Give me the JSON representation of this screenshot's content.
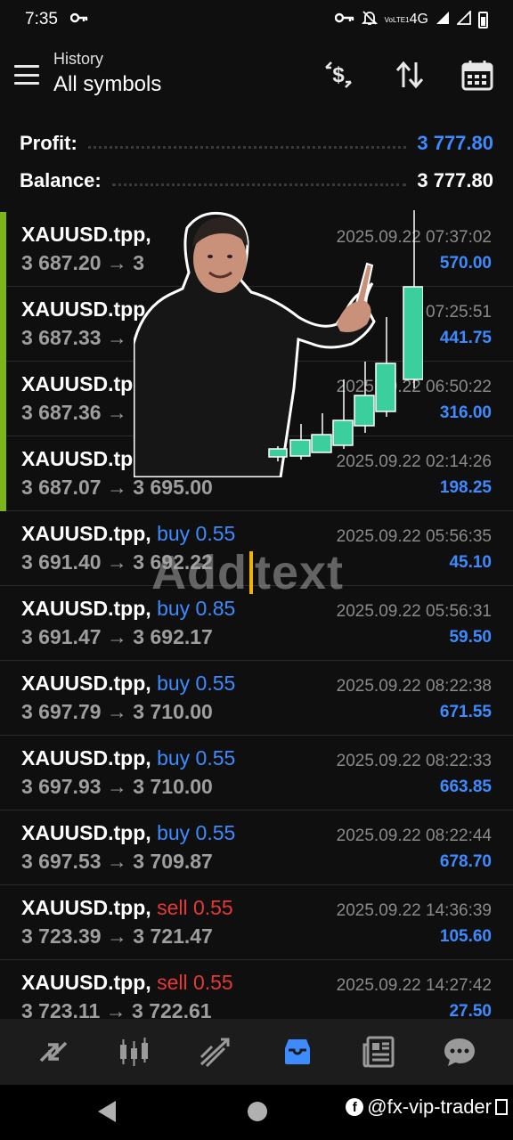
{
  "status": {
    "time": "7:35",
    "network": "4G",
    "volte": "VoLTE1"
  },
  "header": {
    "subtitle": "History",
    "title": "All symbols"
  },
  "summary": {
    "profit_label": "Profit:",
    "profit_value": "3 777.80",
    "balance_label": "Balance:",
    "balance_value": "3 777.80"
  },
  "trades": [
    {
      "symbol": "XAUUSD.tpp,",
      "side": "",
      "side_type": "buy",
      "prices": "3 687.20 → 3",
      "time": "2025.09.22 07:37:02",
      "profit": "570.00",
      "highlight": true
    },
    {
      "symbol": "XAUUSD.tpp",
      "side": "",
      "side_type": "buy",
      "prices": "3 687.33 →",
      "time": "07:25:51",
      "profit": "441.75",
      "highlight": true
    },
    {
      "symbol": "XAUUSD.tpp",
      "side": "",
      "side_type": "buy",
      "prices": "3 687.36 →",
      "time": "2025.09.22 06:50:22",
      "profit": "316.00",
      "highlight": true
    },
    {
      "symbol": "XAUUSD.tpp",
      "side": "",
      "side_type": "buy",
      "prices": "3 687.07 → 3 695.00",
      "time": "2025.09.22 02:14:26",
      "profit": "198.25",
      "highlight": true
    },
    {
      "symbol": "XAUUSD.tpp,",
      "side": "buy 0.55",
      "side_type": "buy",
      "prices": "3 691.40 → 3 692.22",
      "time": "2025.09.22 05:56:35",
      "profit": "45.10",
      "highlight": false
    },
    {
      "symbol": "XAUUSD.tpp,",
      "side": "buy 0.85",
      "side_type": "buy",
      "prices": "3 691.47 → 3 692.17",
      "time": "2025.09.22 05:56:31",
      "profit": "59.50",
      "highlight": false
    },
    {
      "symbol": "XAUUSD.tpp,",
      "side": "buy 0.55",
      "side_type": "buy",
      "prices": "3 697.79 → 3 710.00",
      "time": "2025.09.22 08:22:38",
      "profit": "671.55",
      "highlight": false
    },
    {
      "symbol": "XAUUSD.tpp,",
      "side": "buy 0.55",
      "side_type": "buy",
      "prices": "3 697.93 → 3 710.00",
      "time": "2025.09.22 08:22:33",
      "profit": "663.85",
      "highlight": false
    },
    {
      "symbol": "XAUUSD.tpp,",
      "side": "buy 0.55",
      "side_type": "buy",
      "prices": "3 697.53 → 3 709.87",
      "time": "2025.09.22 08:22:44",
      "profit": "678.70",
      "highlight": false
    },
    {
      "symbol": "XAUUSD.tpp,",
      "side": "sell 0.55",
      "side_type": "sell",
      "prices": "3 723.39 → 3 721.47",
      "time": "2025.09.22 14:36:39",
      "profit": "105.60",
      "highlight": false
    },
    {
      "symbol": "XAUUSD.tpp,",
      "side": "sell 0.55",
      "side_type": "sell",
      "prices": "3 723.11 → 3 722.61",
      "time": "2025.09.22 14:27:42",
      "profit": "27.50",
      "highlight": false
    }
  ],
  "overlay": {
    "add_text_left": "Add",
    "add_text_right": "text"
  },
  "bottom_nav": {
    "items": [
      {
        "icon": "quotes-icon",
        "active": false
      },
      {
        "icon": "chart-icon",
        "active": false
      },
      {
        "icon": "trade-icon",
        "active": false
      },
      {
        "icon": "history-icon",
        "active": true
      },
      {
        "icon": "news-icon",
        "active": false
      },
      {
        "icon": "messages-icon",
        "active": false
      }
    ]
  },
  "watermark": {
    "text": "@fx-vip-trader"
  },
  "colors": {
    "accent": "#3d8bff",
    "sell": "#e53935",
    "profit_bar": "#7cb518",
    "candle": "#3ccf9e"
  }
}
